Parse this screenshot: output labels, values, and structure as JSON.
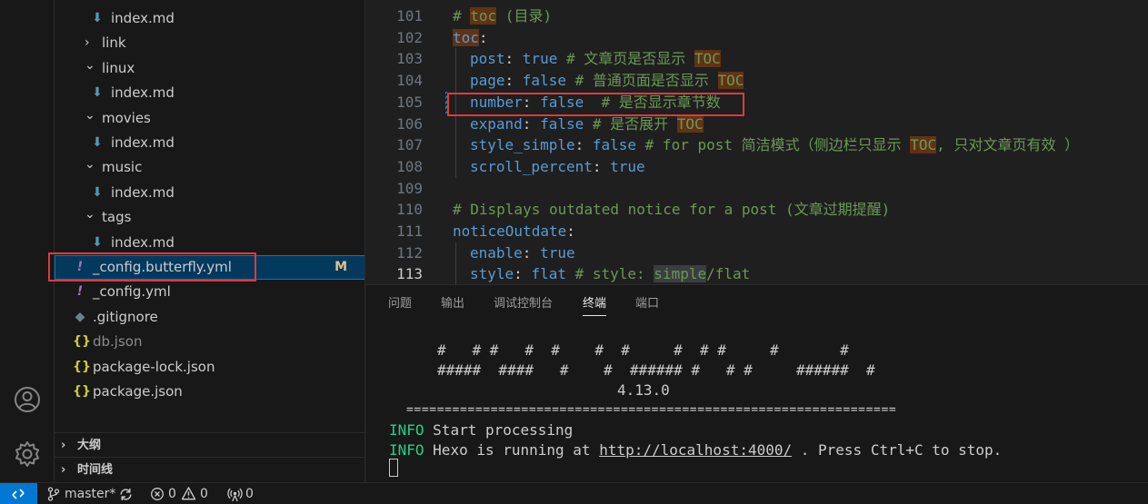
{
  "explorer": {
    "items": [
      {
        "name": "index.md",
        "icon": "markdown-icon",
        "indent": "file2"
      },
      {
        "name": "link",
        "icon": "folder-collapsed",
        "indent": "folder"
      },
      {
        "name": "linux",
        "icon": "folder-expanded",
        "indent": "folder"
      },
      {
        "name": "index.md",
        "icon": "markdown-icon",
        "indent": "file2"
      },
      {
        "name": "movies",
        "icon": "folder-expanded",
        "indent": "folder"
      },
      {
        "name": "index.md",
        "icon": "markdown-icon",
        "indent": "file2"
      },
      {
        "name": "music",
        "icon": "folder-expanded",
        "indent": "folder"
      },
      {
        "name": "index.md",
        "icon": "markdown-icon",
        "indent": "file2"
      },
      {
        "name": "tags",
        "icon": "folder-expanded",
        "indent": "folder"
      },
      {
        "name": "index.md",
        "icon": "markdown-icon",
        "indent": "file2"
      },
      {
        "name": "_config.butterfly.yml",
        "icon": "yaml-icon",
        "indent": "file1",
        "badge": "M",
        "selected": true
      },
      {
        "name": "_config.yml",
        "icon": "yaml-icon",
        "indent": "file1"
      },
      {
        "name": ".gitignore",
        "icon": "git-icon",
        "indent": "file1"
      },
      {
        "name": "db.json",
        "icon": "json-icon",
        "indent": "file1",
        "dim": true
      },
      {
        "name": "package-lock.json",
        "icon": "json-icon",
        "indent": "file1"
      },
      {
        "name": "package.json",
        "icon": "json-icon",
        "indent": "file1"
      }
    ],
    "sections": [
      "大纲",
      "时间线"
    ]
  },
  "editor": {
    "lines": [
      {
        "n": "101",
        "parts": [
          [
            "c-cmt",
            "# "
          ],
          [
            "c-cmt c-hl",
            "toc"
          ],
          [
            "c-cmt",
            " (目录)"
          ]
        ]
      },
      {
        "n": "102",
        "parts": [
          [
            "c-key c-hl",
            "toc"
          ],
          [
            "c-plain",
            ":"
          ]
        ]
      },
      {
        "n": "103",
        "indent": true,
        "parts": [
          [
            "c-key",
            "post"
          ],
          [
            "c-plain",
            ": "
          ],
          [
            "c-key",
            "true"
          ],
          [
            "c-cmt",
            " # 文章页是否显示 "
          ],
          [
            "c-cmt c-hl",
            "TOC"
          ]
        ]
      },
      {
        "n": "104",
        "indent": true,
        "parts": [
          [
            "c-key",
            "page"
          ],
          [
            "c-plain",
            ": "
          ],
          [
            "c-key",
            "false"
          ],
          [
            "c-cmt",
            " # 普通页面是否显示 "
          ],
          [
            "c-cmt c-hl",
            "TOC"
          ]
        ]
      },
      {
        "n": "105",
        "indent": true,
        "modified": true,
        "parts": [
          [
            "c-key",
            "number"
          ],
          [
            "c-plain",
            ": "
          ],
          [
            "c-key",
            "false"
          ],
          [
            "c-cmt",
            "  # 是否显示章节数"
          ]
        ]
      },
      {
        "n": "106",
        "indent": true,
        "parts": [
          [
            "c-key",
            "expand"
          ],
          [
            "c-plain",
            ": "
          ],
          [
            "c-key",
            "false"
          ],
          [
            "c-cmt",
            " # 是否展开 "
          ],
          [
            "c-cmt c-hl",
            "TOC"
          ]
        ]
      },
      {
        "n": "107",
        "indent": true,
        "parts": [
          [
            "c-key",
            "style_simple"
          ],
          [
            "c-plain",
            ": "
          ],
          [
            "c-key",
            "false"
          ],
          [
            "c-cmt",
            " # for post 简洁模式（侧边栏只显示 "
          ],
          [
            "c-cmt c-hl",
            "TOC"
          ],
          [
            "c-cmt",
            ", 只对文章页有效 ）"
          ]
        ]
      },
      {
        "n": "108",
        "indent": true,
        "parts": [
          [
            "c-key",
            "scroll_percent"
          ],
          [
            "c-plain",
            ": "
          ],
          [
            "c-key",
            "true"
          ]
        ]
      },
      {
        "n": "109",
        "parts": []
      },
      {
        "n": "110",
        "parts": [
          [
            "c-cmt",
            "# Displays outdated notice for a post (文章过期提醒)"
          ]
        ]
      },
      {
        "n": "111",
        "parts": [
          [
            "c-key",
            "noticeOutdate"
          ],
          [
            "c-plain",
            ":"
          ]
        ]
      },
      {
        "n": "112",
        "indent": true,
        "parts": [
          [
            "c-key",
            "enable"
          ],
          [
            "c-plain",
            ": "
          ],
          [
            "c-key",
            "true"
          ]
        ]
      },
      {
        "n": "113",
        "indent": true,
        "active": true,
        "parts": [
          [
            "c-key",
            "style"
          ],
          [
            "c-plain",
            ": "
          ],
          [
            "c-key",
            "flat"
          ],
          [
            "c-cmt",
            " # style: "
          ],
          [
            "c-cmt c-hl2",
            "simple"
          ],
          [
            "c-cmt",
            "/flat"
          ]
        ]
      }
    ]
  },
  "panel": {
    "tabs": [
      "问题",
      "输出",
      "调试控制台",
      "终端",
      "端口"
    ],
    "active_tab": "终端",
    "terminal": {
      "banner1": "#   # #   #  #    #  #     #  # #     #       #",
      "banner2": "#####  ####   #    #  ###### #   # #     ######  #",
      "version": "4.13.0",
      "rule": "================================================================",
      "info1_tag": "INFO",
      "info1_text": "Start processing",
      "info2_tag": "INFO",
      "info2_pre": "Hexo is running at ",
      "info2_url": "http://localhost:4000/",
      "info2_post": " . Press Ctrl+C to stop."
    }
  },
  "statusbar": {
    "branch": "master*",
    "errors": "0",
    "warnings": "0",
    "ports": "0"
  },
  "colors": {
    "accent": "#0078d4",
    "annotation": "#e03a3a",
    "modified_badge": "#e2c08d",
    "terminal_info": "#23d18b"
  }
}
